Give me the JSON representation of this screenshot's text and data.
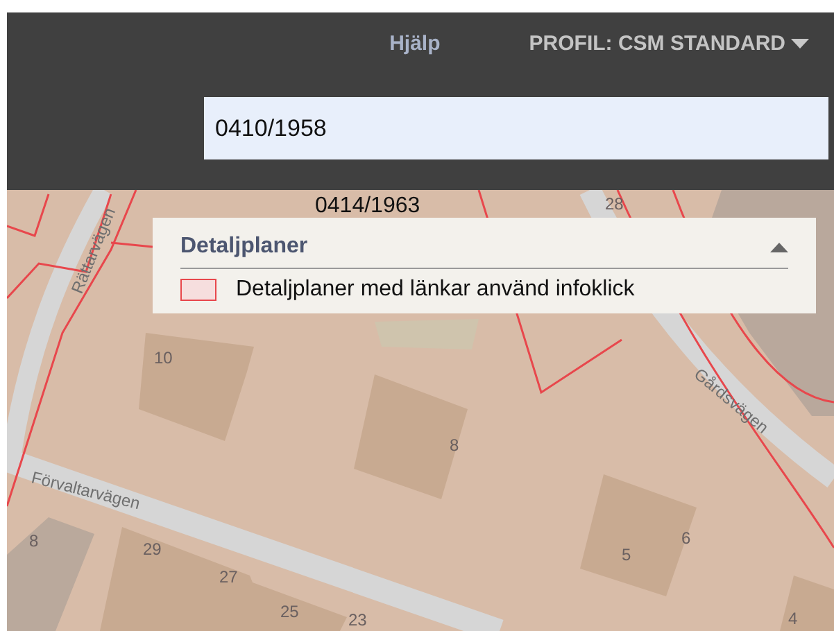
{
  "header": {
    "help_link": "Hjälp",
    "profile_menu": "PROFIL: CSM STANDARD",
    "search": {
      "value": "0410/1958"
    }
  },
  "map": {
    "labels": [
      {
        "kind": "plan-number",
        "text": "0414/1963"
      },
      {
        "kind": "street",
        "text": "Rättarvägen"
      },
      {
        "kind": "house-number",
        "text": "28"
      },
      {
        "kind": "street",
        "text": "Gårdsvägen"
      },
      {
        "kind": "house-number",
        "text": "10"
      },
      {
        "kind": "house-number",
        "text": "8"
      },
      {
        "kind": "street",
        "text": "Förvaltarvägen"
      },
      {
        "kind": "house-number",
        "text": "8"
      },
      {
        "kind": "house-number",
        "text": "29"
      },
      {
        "kind": "house-number",
        "text": "27"
      },
      {
        "kind": "house-number",
        "text": "25"
      },
      {
        "kind": "house-number",
        "text": "23"
      },
      {
        "kind": "house-number",
        "text": "5"
      },
      {
        "kind": "house-number",
        "text": "6"
      },
      {
        "kind": "house-number",
        "text": "4"
      }
    ]
  },
  "legend": {
    "title": "Detaljplaner",
    "expanded": true,
    "items": [
      {
        "label": "Detaljplaner med länkar använd infoklick",
        "color": "#e8474c"
      }
    ]
  }
}
